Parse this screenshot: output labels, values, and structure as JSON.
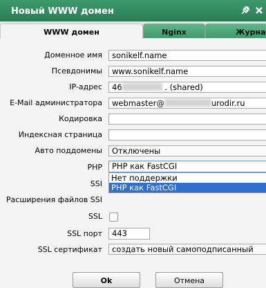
{
  "window": {
    "title": "Новый WWW домен"
  },
  "tabs": [
    {
      "label": "WWW домен",
      "active": true
    },
    {
      "label": "Nginx",
      "active": false
    },
    {
      "label": "Журналь",
      "active": false
    }
  ],
  "form": {
    "domain": {
      "label": "Доменное имя",
      "value": "sonikelf.name"
    },
    "aliases": {
      "label": "Псевдонимы",
      "value": "www.sonikelf.name"
    },
    "ip": {
      "label": "IP-адрес",
      "value_prefix": "46",
      "value_suffix": ". (shared)"
    },
    "email": {
      "label": "E-Mail администратора",
      "value_prefix": "webmaster@",
      "value_suffix": "urodir.ru"
    },
    "encoding": {
      "label": "Кодировка",
      "value": ""
    },
    "index_page": {
      "label": "Индексная страница",
      "value": ""
    },
    "auto_subdomains": {
      "label": "Авто поддомены",
      "value": "Отключены"
    },
    "php": {
      "label": "PHP",
      "value": "PHP как FastCGI",
      "options": [
        "Нет поддержки",
        "PHP как FastCGI"
      ],
      "selected_index": 1
    },
    "ssi": {
      "label": "SSI"
    },
    "ssi_ext": {
      "label": "Расширения файлов SSI"
    },
    "ssl": {
      "label": "SSL",
      "checked": false
    },
    "ssl_port": {
      "label": "SSL порт",
      "value": "443"
    },
    "ssl_cert": {
      "label": "SSL сертификат",
      "value": "создать новый самоподписанный"
    }
  },
  "buttons": {
    "ok": "Ok",
    "cancel": "Отмена"
  },
  "colors": {
    "titlebar": "#2a7d55",
    "inactive_tab": "#3f9a6b",
    "selection": "#2f6fd0"
  }
}
